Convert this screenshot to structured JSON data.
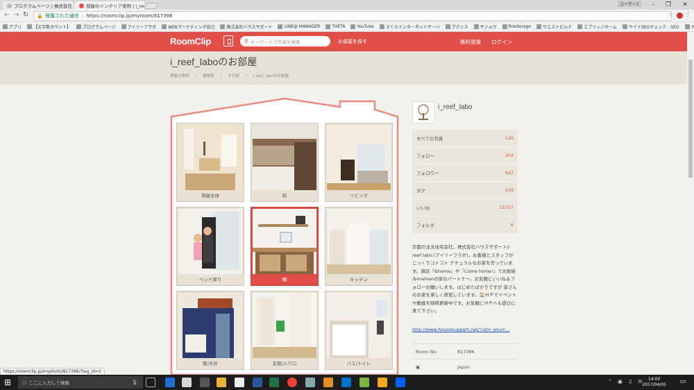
{
  "browser": {
    "tabs": [
      {
        "title": "プログラムページ | 株式会社"
      },
      {
        "title": "部屋のインテリア実例 | i_ree"
      }
    ],
    "window_user": "ユーザー1",
    "secure_label": "保護された通信",
    "url": "https://roomclip.jp/myroom/817396",
    "bookmarks": [
      "アプリ",
      "【文字数カウント】",
      "プログラムページ",
      "アイリーフラボ",
      "WEBマーケティング自己",
      "株式会社ハウスサポート",
      "LINE@ MANAGER",
      "THETA",
      "YouTube",
      "さくらインターネットサーバ",
      "アクシス",
      "サジョウ",
      "firestorage",
      "ウエストビルド",
      "エブリッジホーム",
      "サイトSEOチェック - SEO",
      "ナチュリエ事業部"
    ],
    "status_url": "https://roomclip.jp/myphoto/817396/?tag_id=5"
  },
  "header": {
    "logo": "RoomClip",
    "search_placeholder": "キーワードで写真を検索",
    "find_room": "お部屋を探す",
    "signup": "無料登録",
    "login": "ログイン"
  },
  "page": {
    "title": "i_reef_laboのお部屋",
    "breadcrumbs": [
      "部屋の実例",
      "建築系",
      "その他",
      "i_reef_laboのお部屋"
    ]
  },
  "tiles": [
    {
      "label": "部屋全体"
    },
    {
      "label": "机"
    },
    {
      "label": "リビング"
    },
    {
      "label": "ベッド周り"
    },
    {
      "label": "棚"
    },
    {
      "label": "キッチン"
    },
    {
      "label": "壁/天井"
    },
    {
      "label": "玄関/入り口"
    },
    {
      "label": "バス/トイレ"
    }
  ],
  "profile": {
    "username": "i_reef_labo",
    "stats": [
      {
        "label": "すべての写真",
        "value": "120"
      },
      {
        "label": "フォロー",
        "value": "204"
      },
      {
        "label": "フォロワー",
        "value": "622"
      },
      {
        "label": "タグ",
        "value": "259"
      },
      {
        "label": "いいね",
        "value": "15727"
      },
      {
        "label": "フォルダ",
        "value": "6"
      }
    ],
    "bio": "京都の注文住宅会社。株式会社ハウスサポート/i reef labo.(アイリーフラボ)。お客様とスタッフがじっくりコトコト ナチュラルなお家を作っています。雑誌『&home』や『Come home!』でお馴染みmamanの家のパートナー。お気軽にいいね＆フォローお願いします。はじめたばかりですが 皆さんのお家を楽しく拝見しています。🏠ＨＰでイベントや動画を随時更新中です。お気軽にＨＰへも遊びに来て下さい。",
    "link": "http://www.housesupport.net/?utm_sourc...",
    "room_no_label": "Room No.",
    "room_no": "817396",
    "country": "Japan"
  },
  "taskbar": {
    "search_placeholder": "ここに入力して検索",
    "time": "14:00",
    "date": "2017/04/05"
  }
}
